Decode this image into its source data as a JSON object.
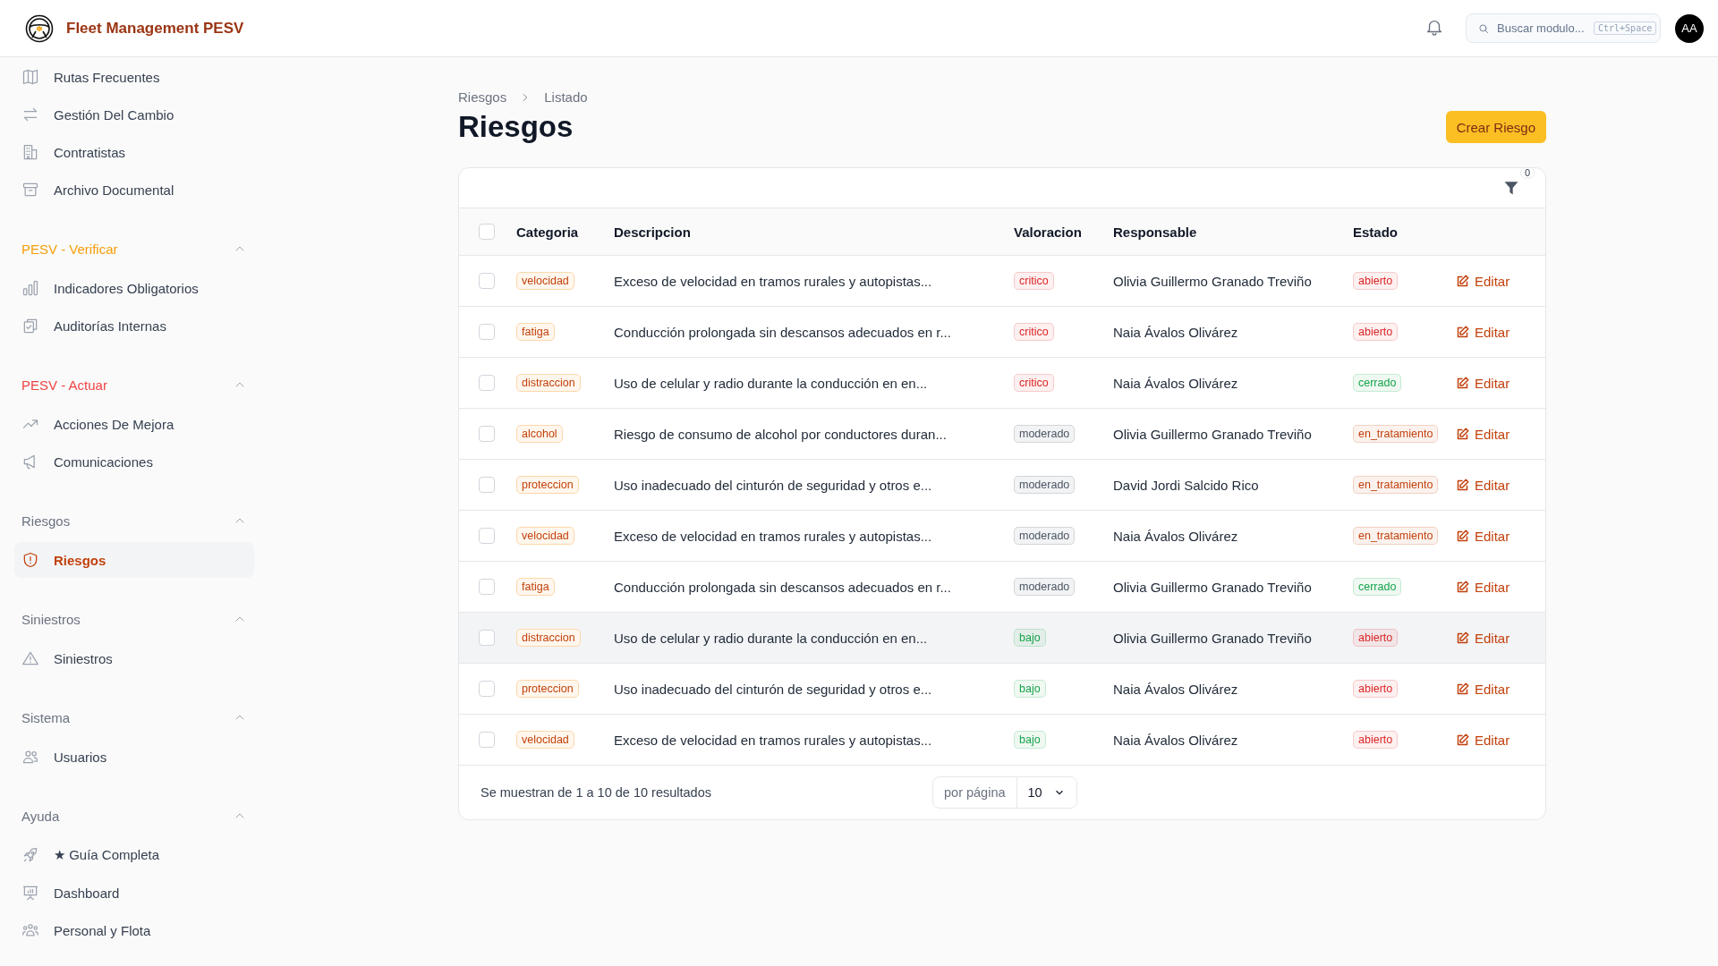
{
  "app": {
    "title": "Fleet Management PESV"
  },
  "topbar": {
    "search": {
      "placeholder": "Buscar modulo...",
      "shortcut": "Ctrl+Space"
    },
    "avatar": "AA"
  },
  "sidebar": {
    "groups": [
      {
        "items": [
          {
            "label": "Rutas Frecuentes",
            "selected": false
          },
          {
            "label": "Gestión Del Cambio",
            "selected": false
          },
          {
            "label": "Contratistas",
            "selected": false
          },
          {
            "label": "Archivo Documental",
            "selected": false
          }
        ]
      },
      {
        "title": "PESV - Verificar",
        "color": "#f59e0b",
        "expanded": true,
        "items": [
          {
            "label": "Indicadores Obligatorios",
            "selected": false
          },
          {
            "label": "Auditorías Internas",
            "selected": false
          }
        ]
      },
      {
        "title": "PESV - Actuar",
        "color": "#ef4444",
        "expanded": true,
        "items": [
          {
            "label": "Acciones De Mejora",
            "selected": false
          },
          {
            "label": "Comunicaciones",
            "selected": false
          }
        ]
      },
      {
        "title": "Riesgos",
        "color": "#6b7280",
        "expanded": true,
        "items": [
          {
            "label": "Riesgos",
            "selected": true
          }
        ]
      },
      {
        "title": "Siniestros",
        "color": "#6b7280",
        "expanded": true,
        "items": [
          {
            "label": "Siniestros",
            "selected": false
          }
        ]
      },
      {
        "title": "Sistema",
        "color": "#6b7280",
        "expanded": true,
        "items": [
          {
            "label": "Usuarios",
            "selected": false
          }
        ]
      },
      {
        "title": "Ayuda",
        "color": "#6b7280",
        "expanded": true,
        "items": [
          {
            "label": "★ Guía Completa",
            "selected": false
          },
          {
            "label": "Dashboard",
            "selected": false
          },
          {
            "label": "Personal y Flota",
            "selected": false
          }
        ]
      }
    ]
  },
  "page": {
    "breadcrumb": [
      "Riesgos",
      "Listado"
    ],
    "title": "Riesgos",
    "create_button": "Crear Riesgo"
  },
  "table": {
    "filter_count": "0",
    "all_selected": false,
    "columns": [
      "Categoria",
      "Descripcion",
      "Valoracion",
      "Responsable",
      "Estado"
    ],
    "rows": [
      {
        "selected": false,
        "highlighted": false,
        "categoria": "velocidad",
        "descripcion": "Exceso de velocidad en tramos rurales y autopistas...",
        "valoracion": {
          "text": "critico",
          "color": "#dc2626"
        },
        "responsable": "Olivia Guillermo Granado Treviño",
        "estado": {
          "text": "abierto",
          "color": "#dc2626"
        },
        "action": "Editar"
      },
      {
        "selected": false,
        "highlighted": false,
        "categoria": "fatiga",
        "descripcion": "Conducción prolongada sin descansos adecuados en r...",
        "valoracion": {
          "text": "critico",
          "color": "#dc2626"
        },
        "responsable": "Naia Ávalos Olivárez",
        "estado": {
          "text": "abierto",
          "color": "#dc2626"
        },
        "action": "Editar"
      },
      {
        "selected": false,
        "highlighted": false,
        "categoria": "distraccion",
        "descripcion": "Uso de celular y radio durante la conducción en en...",
        "valoracion": {
          "text": "critico",
          "color": "#dc2626"
        },
        "responsable": "Naia Ávalos Olivárez",
        "estado": {
          "text": "cerrado",
          "color": "#16a34a"
        },
        "action": "Editar"
      },
      {
        "selected": false,
        "highlighted": false,
        "categoria": "alcohol",
        "descripcion": "Riesgo de consumo de alcohol por conductores duran...",
        "valoracion": {
          "text": "moderado",
          "color": "#4b5563"
        },
        "responsable": "Olivia Guillermo Granado Treviño",
        "estado": {
          "text": "en_tratamiento",
          "color": "#c2410c"
        },
        "action": "Editar"
      },
      {
        "selected": false,
        "highlighted": false,
        "categoria": "proteccion",
        "descripcion": "Uso inadecuado del cinturón de seguridad y otros e...",
        "valoracion": {
          "text": "moderado",
          "color": "#4b5563"
        },
        "responsable": "David Jordi Salcido Rico",
        "estado": {
          "text": "en_tratamiento",
          "color": "#c2410c"
        },
        "action": "Editar"
      },
      {
        "selected": false,
        "highlighted": false,
        "categoria": "velocidad",
        "descripcion": "Exceso de velocidad en tramos rurales y autopistas...",
        "valoracion": {
          "text": "moderado",
          "color": "#4b5563"
        },
        "responsable": "Naia Ávalos Olivárez",
        "estado": {
          "text": "en_tratamiento",
          "color": "#c2410c"
        },
        "action": "Editar"
      },
      {
        "selected": false,
        "highlighted": false,
        "categoria": "fatiga",
        "descripcion": "Conducción prolongada sin descansos adecuados en r...",
        "valoracion": {
          "text": "moderado",
          "color": "#4b5563"
        },
        "responsable": "Olivia Guillermo Granado Treviño",
        "estado": {
          "text": "cerrado",
          "color": "#16a34a"
        },
        "action": "Editar"
      },
      {
        "selected": false,
        "highlighted": true,
        "categoria": "distraccion",
        "descripcion": "Uso de celular y radio durante la conducción en en...",
        "valoracion": {
          "text": "bajo",
          "color": "#16a34a"
        },
        "responsable": "Olivia Guillermo Granado Treviño",
        "estado": {
          "text": "abierto",
          "color": "#dc2626"
        },
        "action": "Editar"
      },
      {
        "selected": false,
        "highlighted": false,
        "categoria": "proteccion",
        "descripcion": "Uso inadecuado del cinturón de seguridad y otros e...",
        "valoracion": {
          "text": "bajo",
          "color": "#16a34a"
        },
        "responsable": "Naia Ávalos Olivárez",
        "estado": {
          "text": "abierto",
          "color": "#dc2626"
        },
        "action": "Editar"
      },
      {
        "selected": false,
        "highlighted": false,
        "categoria": "velocidad",
        "descripcion": "Exceso de velocidad en tramos rurales y autopistas...",
        "valoracion": {
          "text": "bajo",
          "color": "#16a34a"
        },
        "responsable": "Naia Ávalos Olivárez",
        "estado": {
          "text": "abierto",
          "color": "#dc2626"
        },
        "action": "Editar"
      }
    ],
    "footer": {
      "summary": "Se muestran de 1 a 10 de 10 resultados",
      "per_page_label": "por página",
      "per_page_value": "10"
    }
  }
}
